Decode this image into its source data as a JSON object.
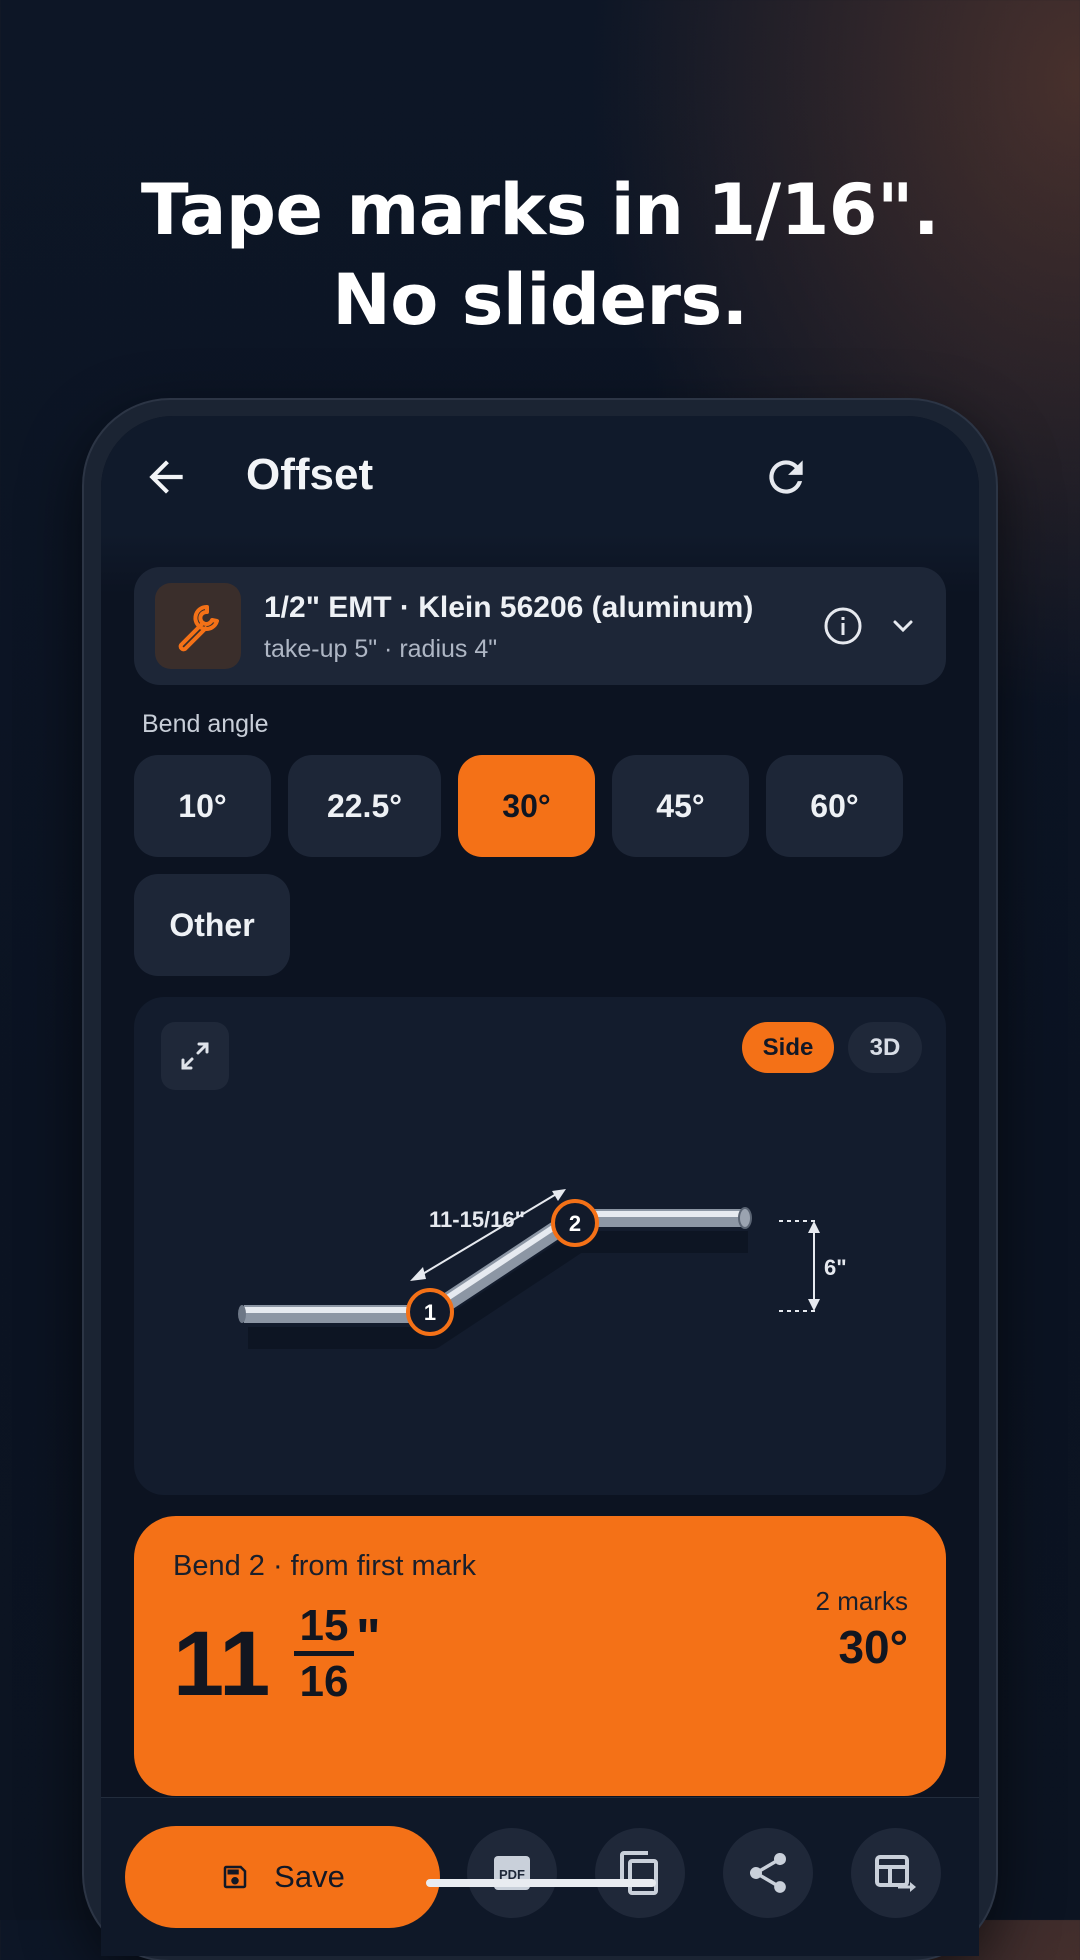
{
  "headline": {
    "line1": "Tape marks in 1/16\".",
    "line2": "No sliders."
  },
  "app": {
    "title": "Offset"
  },
  "tool": {
    "name": "1/2\" EMT · Klein 56206 (aluminum)",
    "sub": "take-up 5\" · radius 4\"",
    "icon": "wrench-icon",
    "icon_color": "#f47117"
  },
  "bend_angle": {
    "label": "Bend angle",
    "options": [
      "10°",
      "22.5°",
      "30°",
      "45°",
      "60°",
      "Other"
    ],
    "selected": "30°"
  },
  "view": {
    "side_label": "Side",
    "three_d_label": "3D",
    "selected": "Side"
  },
  "diagram": {
    "length_label": "11-15/16\"",
    "offset_label": "6\"",
    "mark1": "1",
    "mark2": "2"
  },
  "result": {
    "label": "Bend 2 · from first mark",
    "whole": "11",
    "numerator": "15",
    "denominator": "16",
    "unit": "\"",
    "marks": "2 marks",
    "angle": "30°"
  },
  "actions": {
    "save_label": "Save"
  },
  "colors": {
    "accent": "#f47117",
    "card": "#1d2637",
    "background": "#0c1321"
  }
}
